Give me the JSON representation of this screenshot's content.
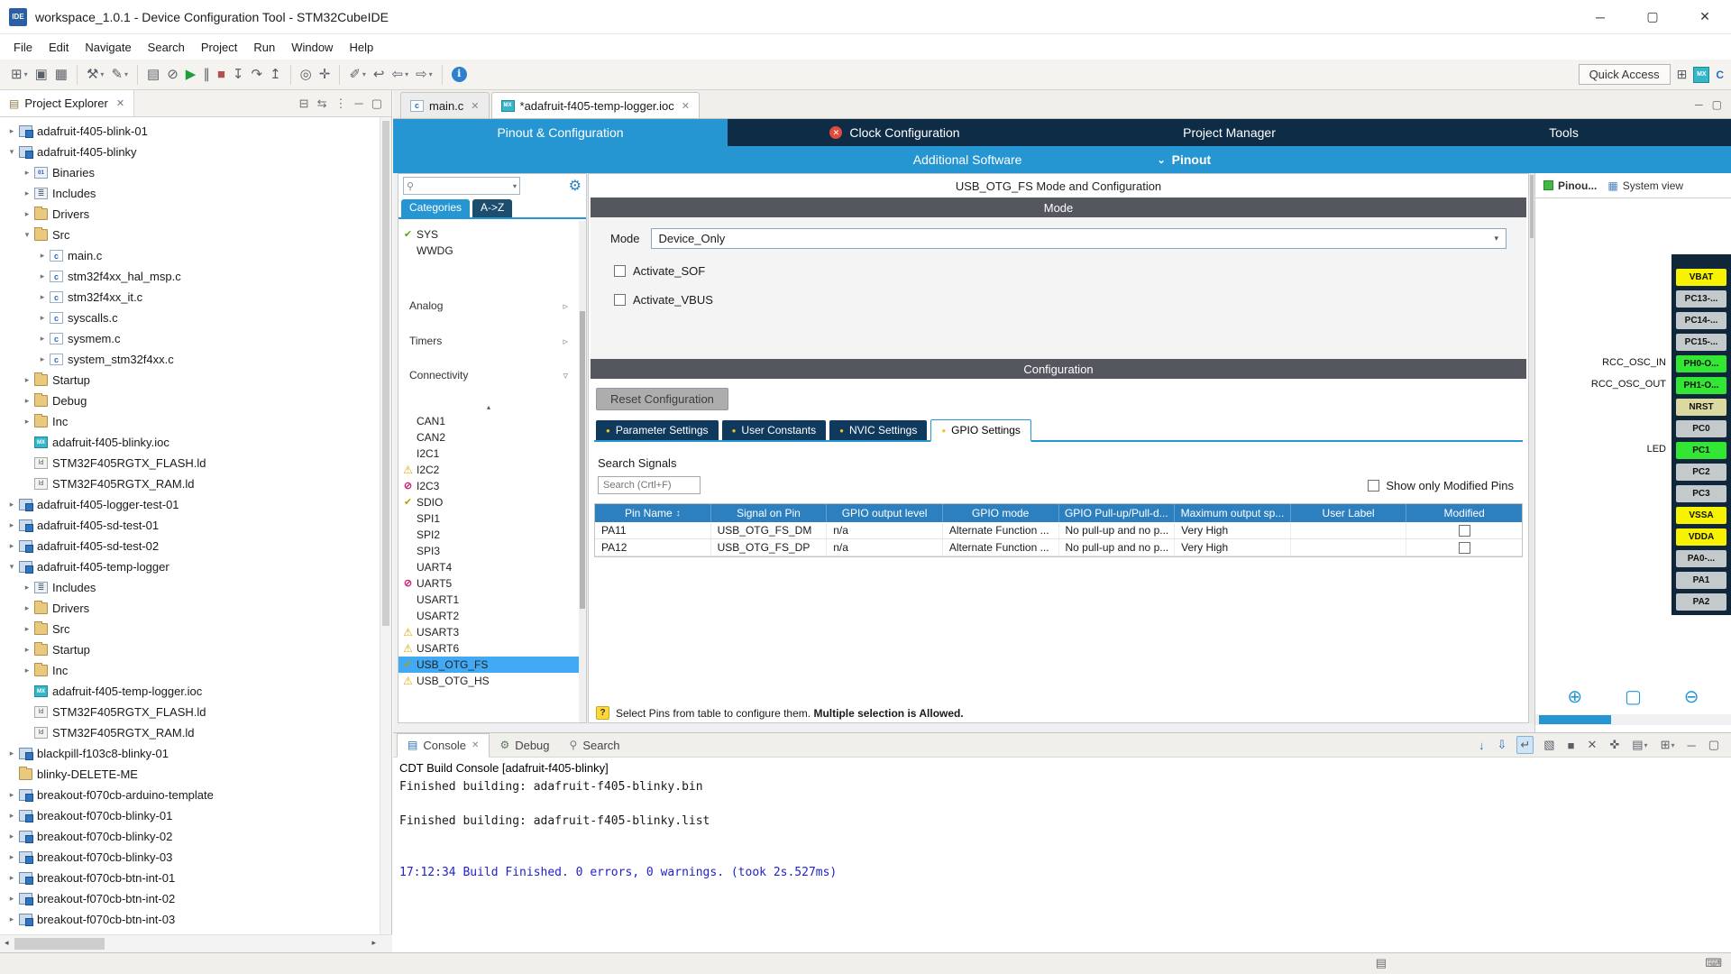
{
  "colors": {
    "accent_blue": "#2596d2",
    "dark_navy": "#0e2c45",
    "section_header_gray": "#54575d",
    "table_header_blue": "#2d80c0",
    "selection_blue": "#42aaf5",
    "console_info_blue": "#2121cc",
    "error_red": "#e04b3f",
    "warning_yellow": "#e8a800",
    "pin_power_yellow": "#f6f200",
    "pin_active_green": "#33e633",
    "pin_reset_khaki": "#d9d9a0",
    "pin_default_gray": "#c4c9cb"
  },
  "window": {
    "title": "workspace_1.0.1 - Device Configuration Tool - STM32CubeIDE",
    "app_icon": "IDE",
    "controls": [
      {
        "name": "minimize",
        "glyph": "─"
      },
      {
        "name": "maximize",
        "glyph": "▢"
      },
      {
        "name": "close",
        "glyph": "✕"
      }
    ]
  },
  "menubar": {
    "items": [
      "File",
      "Edit",
      "Navigate",
      "Search",
      "Project",
      "Run",
      "Window",
      "Help"
    ]
  },
  "toolbar": {
    "quick_access_label": "Quick Access",
    "icons": [
      {
        "name": "new-wizard",
        "glyph": "⊞",
        "caret": true
      },
      {
        "name": "save",
        "glyph": "▣"
      },
      {
        "name": "save-all",
        "glyph": "▦"
      },
      {
        "name": "separator"
      },
      {
        "name": "build-variant",
        "glyph": "⚒",
        "caret": true
      },
      {
        "name": "code-style",
        "glyph": "✎",
        "caret": true
      },
      {
        "name": "separator"
      },
      {
        "name": "open-console",
        "glyph": "▤"
      },
      {
        "name": "skip-breakpoints",
        "glyph": "⊘"
      },
      {
        "name": "resume",
        "glyph": "▶",
        "tint": "green"
      },
      {
        "name": "suspend",
        "glyph": "∥"
      },
      {
        "name": "terminate",
        "glyph": "■",
        "tint": "red"
      },
      {
        "name": "step-into",
        "glyph": "↧"
      },
      {
        "name": "step-over",
        "glyph": "↷"
      },
      {
        "name": "step-return",
        "glyph": "↥"
      },
      {
        "name": "separator"
      },
      {
        "name": "profile",
        "glyph": "◎"
      },
      {
        "name": "coverage",
        "glyph": "✛"
      },
      {
        "name": "separator"
      },
      {
        "name": "annotations",
        "glyph": "✐",
        "caret": true
      },
      {
        "name": "last-edit-location",
        "glyph": "↩"
      },
      {
        "name": "back",
        "glyph": "⇦",
        "caret": true
      },
      {
        "name": "forward",
        "glyph": "⇨",
        "caret": true
      },
      {
        "name": "separator"
      },
      {
        "name": "info",
        "glyph": "ℹ",
        "tint": "info"
      }
    ],
    "perspective_icons": [
      {
        "name": "open-perspective",
        "glyph": "⊞"
      },
      {
        "name": "device-configuration-perspective",
        "glyph": "MX",
        "tint": "mx"
      },
      {
        "name": "cpp-perspective",
        "glyph": "C",
        "tint": "cpp"
      }
    ]
  },
  "explorer": {
    "title": "Project Explorer",
    "header_icons": [
      {
        "name": "collapse-all",
        "glyph": "⊟"
      },
      {
        "name": "link-with-editor",
        "glyph": "⇆"
      },
      {
        "name": "view-menu",
        "glyph": "⋮"
      },
      {
        "name": "minimize-view",
        "glyph": "─"
      },
      {
        "name": "maximize-view",
        "glyph": "▢"
      }
    ],
    "tree": [
      {
        "label": "adafruit-f405-blink-01",
        "level": 0,
        "arrow": "col",
        "icon": "project"
      },
      {
        "label": "adafruit-f405-blinky",
        "level": 0,
        "arrow": "exp",
        "icon": "project"
      },
      {
        "label": "Binaries",
        "level": 1,
        "arrow": "col",
        "icon": "bin"
      },
      {
        "label": "Includes",
        "level": 1,
        "arrow": "col",
        "icon": "inc"
      },
      {
        "label": "Drivers",
        "level": 1,
        "arrow": "col",
        "icon": "folder"
      },
      {
        "label": "Src",
        "level": 1,
        "arrow": "exp",
        "icon": "folder"
      },
      {
        "label": "main.c",
        "level": 2,
        "arrow": "col",
        "icon": "cfile"
      },
      {
        "label": "stm32f4xx_hal_msp.c",
        "level": 2,
        "arrow": "col",
        "icon": "cfile"
      },
      {
        "label": "stm32f4xx_it.c",
        "level": 2,
        "arrow": "col",
        "icon": "cfile"
      },
      {
        "label": "syscal​ls.c",
        "level": 2,
        "arrow": "col",
        "icon": "cfile"
      },
      {
        "label": "sysmem.c",
        "level": 2,
        "arrow": "col",
        "icon": "cfile"
      },
      {
        "label": "system_stm32f4xx.c",
        "level": 2,
        "arrow": "col",
        "icon": "cfile"
      },
      {
        "label": "Startup",
        "level": 1,
        "arrow": "col",
        "icon": "folder"
      },
      {
        "label": "Debug",
        "level": 1,
        "arrow": "col",
        "icon": "folder"
      },
      {
        "label": "Inc",
        "level": 1,
        "arrow": "col",
        "icon": "folder"
      },
      {
        "label": "adafruit-f405-blinky.ioc",
        "level": 1,
        "arrow": "none",
        "icon": "ioc"
      },
      {
        "label": "STM32F405RGTX_FLASH.ld",
        "level": 1,
        "arrow": "none",
        "icon": "ld"
      },
      {
        "label": "STM32F405RGTX_RAM.ld",
        "level": 1,
        "arrow": "none",
        "icon": "ld"
      },
      {
        "label": "adafruit-f405-logger-test-01",
        "level": 0,
        "arrow": "col",
        "icon": "project"
      },
      {
        "label": "adafruit-f405-sd-test-01",
        "level": 0,
        "arrow": "col",
        "icon": "project"
      },
      {
        "label": "adafruit-f405-sd-test-02",
        "level": 0,
        "arrow": "col",
        "icon": "project"
      },
      {
        "label": "adafruit-f405-temp-logger",
        "level": 0,
        "arrow": "exp",
        "icon": "project"
      },
      {
        "label": "Includes",
        "level": 1,
        "arrow": "col",
        "icon": "inc"
      },
      {
        "label": "Drivers",
        "level": 1,
        "arrow": "col",
        "icon": "folder"
      },
      {
        "label": "Src",
        "level": 1,
        "arrow": "col",
        "icon": "folder"
      },
      {
        "label": "Startup",
        "level": 1,
        "arrow": "col",
        "icon": "folder"
      },
      {
        "label": "Inc",
        "level": 1,
        "arrow": "col",
        "icon": "folder"
      },
      {
        "label": "adafruit-f405-temp-logger.ioc",
        "level": 1,
        "arrow": "none",
        "icon": "ioc"
      },
      {
        "label": "STM32F405RGTX_FLASH.ld",
        "level": 1,
        "arrow": "none",
        "icon": "ld"
      },
      {
        "label": "STM32F405RGTX_RAM.ld",
        "level": 1,
        "arrow": "none",
        "icon": "ld"
      },
      {
        "label": "blackpill-f103c8-blinky-01",
        "level": 0,
        "arrow": "col",
        "icon": "project"
      },
      {
        "label": "blinky-DELETE-ME",
        "level": 0,
        "arrow": "none",
        "icon": "folder"
      },
      {
        "label": "breakout-f070cb-arduino-template",
        "level": 0,
        "arrow": "col",
        "icon": "project"
      },
      {
        "label": "breakout-f070cb-blinky-01",
        "level": 0,
        "arrow": "col",
        "icon": "project"
      },
      {
        "label": "breakout-f070cb-blinky-02",
        "level": 0,
        "arrow": "col",
        "icon": "project"
      },
      {
        "label": "breakout-f070cb-blinky-03",
        "level": 0,
        "arrow": "col",
        "icon": "project"
      },
      {
        "label": "breakout-f070cb-btn-int-01",
        "level": 0,
        "arrow": "col",
        "icon": "project"
      },
      {
        "label": "breakout-f070cb-btn-int-02",
        "level": 0,
        "arrow": "col",
        "icon": "project"
      },
      {
        "label": "breakout-f070cb-btn-int-03",
        "level": 0,
        "arrow": "col",
        "icon": "project"
      }
    ]
  },
  "editor": {
    "tabs": [
      {
        "label": "main.c",
        "icon": "c",
        "active": false
      },
      {
        "label": "*adafruit-f405-temp-logger.ioc",
        "icon": "mx",
        "active": true
      }
    ],
    "area_icons": [
      {
        "name": "minimize-editor",
        "glyph": "─"
      },
      {
        "name": "maximize-editor",
        "glyph": "▢"
      }
    ]
  },
  "device_config": {
    "main_tabs": [
      {
        "label": "Pinout & Configuration",
        "active": true
      },
      {
        "label": "Clock Configuration",
        "error": true
      },
      {
        "label": "Project Manager",
        "active": false
      },
      {
        "label": "Tools",
        "active": false
      }
    ],
    "software_bar": {
      "additional": "Additional Software",
      "pinout": "Pinout"
    },
    "peripherals": {
      "search_placeholder": "",
      "tabs": [
        {
          "label": "Categories",
          "active": true
        },
        {
          "label": "A->Z",
          "active": false
        }
      ],
      "items": [
        {
          "kind": "item",
          "label": "SYS",
          "icon": "check-green"
        },
        {
          "kind": "item",
          "label": "WWDG",
          "icon": "none"
        },
        {
          "kind": "section",
          "label": "Analog",
          "state": "col",
          "gap": 40
        },
        {
          "kind": "section",
          "label": "Timers",
          "state": "col",
          "gap": 15
        },
        {
          "kind": "section",
          "label": "Connectivity",
          "state": "exp",
          "gap": 14
        },
        {
          "kind": "scroll-up",
          "gap": 18
        },
        {
          "kind": "item",
          "label": "CAN1",
          "icon": "none"
        },
        {
          "kind": "item",
          "label": "CAN2",
          "icon": "none"
        },
        {
          "kind": "item",
          "label": "I2C1",
          "icon": "none"
        },
        {
          "kind": "item",
          "label": "I2C2",
          "icon": "warn"
        },
        {
          "kind": "item",
          "label": "I2C3",
          "icon": "ban"
        },
        {
          "kind": "item",
          "label": "SDIO",
          "icon": "check-yellow"
        },
        {
          "kind": "item",
          "label": "SPI1",
          "icon": "none"
        },
        {
          "kind": "item",
          "label": "SPI2",
          "icon": "none"
        },
        {
          "kind": "item",
          "label": "SPI3",
          "icon": "none"
        },
        {
          "kind": "item",
          "label": "UART4",
          "icon": "none"
        },
        {
          "kind": "item",
          "label": "UART5",
          "icon": "ban"
        },
        {
          "kind": "item",
          "label": "USART1",
          "icon": "none"
        },
        {
          "kind": "item",
          "label": "USART2",
          "icon": "none"
        },
        {
          "kind": "item",
          "label": "USART3",
          "icon": "warn"
        },
        {
          "kind": "item",
          "label": "USART6",
          "icon": "warn"
        },
        {
          "kind": "item",
          "label": "USB_OTG_FS",
          "icon": "check-yellow",
          "selected": true
        },
        {
          "kind": "item",
          "label": "USB_OTG_HS",
          "icon": "warn"
        }
      ]
    },
    "mode_panel": {
      "panel_title": "USB_OTG_FS Mode and Configuration",
      "section_title": "Mode",
      "field_label": "Mode",
      "field_value": "Device_Only",
      "checkboxes": [
        {
          "label": "Activate_SOF",
          "checked": false
        },
        {
          "label": "Activate_VBUS",
          "checked": false
        }
      ]
    },
    "config_panel": {
      "section_title": "Configuration",
      "reset_label": "Reset Configuration",
      "tabs": [
        {
          "label": "Parameter Settings",
          "active": false
        },
        {
          "label": "User Constants",
          "active": false
        },
        {
          "label": "NVIC Settings",
          "active": false
        },
        {
          "label": "GPIO Settings",
          "active": true
        }
      ],
      "search_label": "Search Signals",
      "search_placeholder": "Search (Crtl+F)",
      "modified_filter_label": "Show only Modified Pins",
      "modified_filter_checked": false,
      "table": {
        "columns": [
          "Pin Name",
          "Signal on Pin",
          "GPIO output level",
          "GPIO mode",
          "GPIO Pull-up/Pull-d...",
          "Maximum output sp...",
          "User Label",
          "Modified"
        ],
        "sort_column": "Pin Name",
        "sort_icon": "↕",
        "rows": [
          {
            "pin": "PA11",
            "signal": "USB_OTG_FS_DM",
            "level": "n/a",
            "mode": "Alternate Function ...",
            "pull": "No pull-up and no p...",
            "speed": "Very High",
            "user_label": "",
            "modified": false
          },
          {
            "pin": "PA12",
            "signal": "USB_OTG_FS_DP",
            "level": "n/a",
            "mode": "Alternate Function ...",
            "pull": "No pull-up and no p...",
            "speed": "Very High",
            "user_label": "",
            "modified": false
          }
        ]
      },
      "hint_icon": "?",
      "hint_text": "Select Pins from table to configure them. ",
      "hint_bold": "Multiple selection is Allowed."
    },
    "pinout_view": {
      "tabs": [
        {
          "label": "Pinou...",
          "active": true,
          "icon": "chip"
        },
        {
          "label": "System view",
          "active": false,
          "icon": "grid"
        }
      ],
      "pins": [
        {
          "name": "VBAT",
          "color": "power"
        },
        {
          "name": "PC13-...",
          "color": "default"
        },
        {
          "name": "PC14-...",
          "color": "default"
        },
        {
          "name": "PC15-...",
          "color": "default"
        },
        {
          "name": "PH0-O...",
          "color": "active",
          "signal": "RCC_OSC_IN"
        },
        {
          "name": "PH1-O...",
          "color": "active",
          "signal": "RCC_OSC_OUT"
        },
        {
          "name": "NRST",
          "color": "reset"
        },
        {
          "name": "PC0",
          "color": "default"
        },
        {
          "name": "PC1",
          "color": "active",
          "signal": "LED"
        },
        {
          "name": "PC2",
          "color": "default"
        },
        {
          "name": "PC3",
          "color": "default"
        },
        {
          "name": "VSSA",
          "color": "power"
        },
        {
          "name": "VDDA",
          "color": "power"
        },
        {
          "name": "PA0-...",
          "color": "default"
        },
        {
          "name": "PA1",
          "color": "default"
        },
        {
          "name": "PA2",
          "color": "default"
        }
      ],
      "zoom_icons": [
        {
          "name": "zoom-in",
          "glyph": "⊕"
        },
        {
          "name": "fit-view",
          "glyph": "▢"
        },
        {
          "name": "zoom-out",
          "glyph": "⊖"
        }
      ]
    }
  },
  "console": {
    "tabs": [
      {
        "label": "Console",
        "active": true,
        "icon": "console",
        "closable": true
      },
      {
        "label": "Debug",
        "active": false,
        "icon": "debug"
      },
      {
        "label": "Search",
        "active": false,
        "icon": "search"
      }
    ],
    "toolbar_icons": [
      {
        "name": "scroll-to-end",
        "glyph": "↓",
        "tint": "blue"
      },
      {
        "name": "scroll-lock",
        "glyph": "⇩",
        "tint": "blue"
      },
      {
        "name": "word-wrap",
        "glyph": "↵",
        "active": true
      },
      {
        "name": "clear-console",
        "glyph": "▧"
      },
      {
        "name": "terminate",
        "glyph": "■"
      },
      {
        "name": "remove-launch",
        "glyph": "✕"
      },
      {
        "name": "pin-console",
        "glyph": "✜"
      },
      {
        "name": "display-selected-console",
        "glyph": "▤",
        "caret": true
      },
      {
        "name": "open-console",
        "glyph": "⊞",
        "caret": true
      },
      {
        "name": "minimize-view",
        "glyph": "─"
      },
      {
        "name": "maximize-view",
        "glyph": "▢"
      }
    ],
    "title_line": "CDT Build Console [adafruit-f405-blinky]",
    "lines": [
      {
        "text": "Finished building: adafruit-f405-blinky.bin",
        "color": "default"
      },
      {
        "text": "",
        "color": "default"
      },
      {
        "text": "Finished building: adafruit-f405-blinky.list",
        "color": "default"
      },
      {
        "text": "",
        "color": "default"
      },
      {
        "text": "",
        "color": "default"
      },
      {
        "text": "17:12:34 Build Finished. 0 errors, 0 warnings. (took 2s.527ms)",
        "color": "info"
      }
    ]
  },
  "statusbar": {
    "icons": [
      {
        "name": "build-console-indicator",
        "glyph": "▤"
      },
      {
        "name": "input-method-indicator",
        "glyph": "⌨"
      }
    ]
  }
}
